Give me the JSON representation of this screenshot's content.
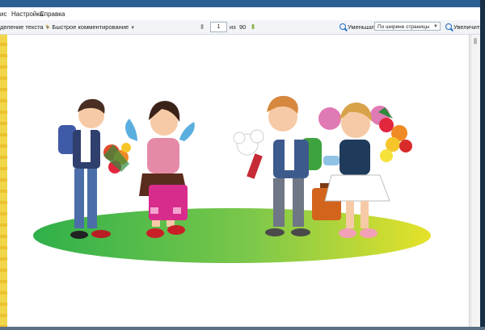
{
  "menu": {
    "items": [
      "ис",
      "Настройка",
      "Справка"
    ]
  },
  "toolbar": {
    "select_text_label": "деление текста",
    "quick_comment_label": "Быстрое комментирование",
    "page_current": "1",
    "page_of": "из",
    "page_total": "90",
    "zoom_out_label": "Уменьшить",
    "zoom_mode": "По ширине страницы",
    "zoom_in_label": "Увеличить"
  },
  "colors": {
    "titlebar": "#2b5f93",
    "accent": "#1c6ac7",
    "ground_green": "#2fb04a",
    "ground_yellow": "#e6e22a"
  },
  "icons": [
    "select-text-icon",
    "quick-comment-icon",
    "page-prev-icon",
    "page-next-icon",
    "zoom-out-icon",
    "zoom-in-icon"
  ]
}
